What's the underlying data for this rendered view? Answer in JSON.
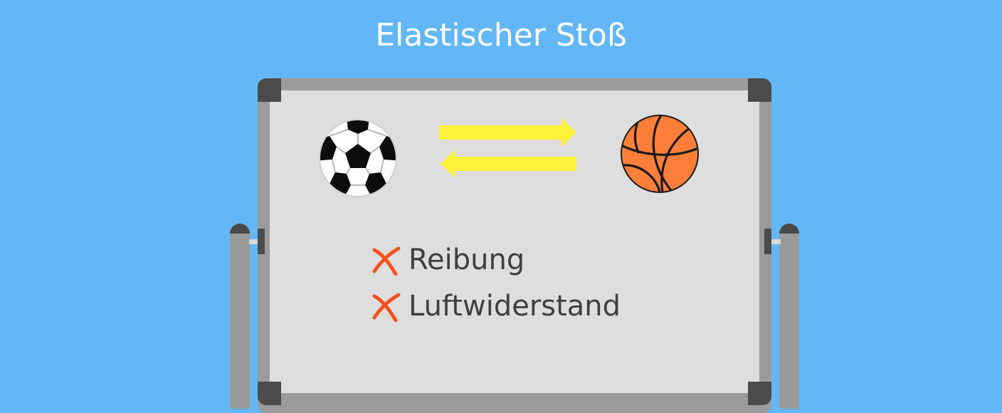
{
  "title": "Elastischer Stoß",
  "board": {
    "objects": [
      {
        "icon": "soccer-ball-icon"
      },
      {
        "icon": "basketball-icon"
      }
    ],
    "arrows": [
      {
        "icon": "arrow-right-icon",
        "color": "#fff23a"
      },
      {
        "icon": "arrow-left-icon",
        "color": "#fff23a"
      }
    ],
    "excluded": [
      {
        "label": "Reibung",
        "icon": "cross-icon",
        "color": "#f4511e"
      },
      {
        "label": "Luftwiderstand",
        "icon": "cross-icon",
        "color": "#f4511e"
      }
    ]
  },
  "colors": {
    "background": "#63b7f7",
    "board_surface": "#dedede",
    "board_frame": "#9b9b9b",
    "basketball": "#ff7f3a"
  }
}
